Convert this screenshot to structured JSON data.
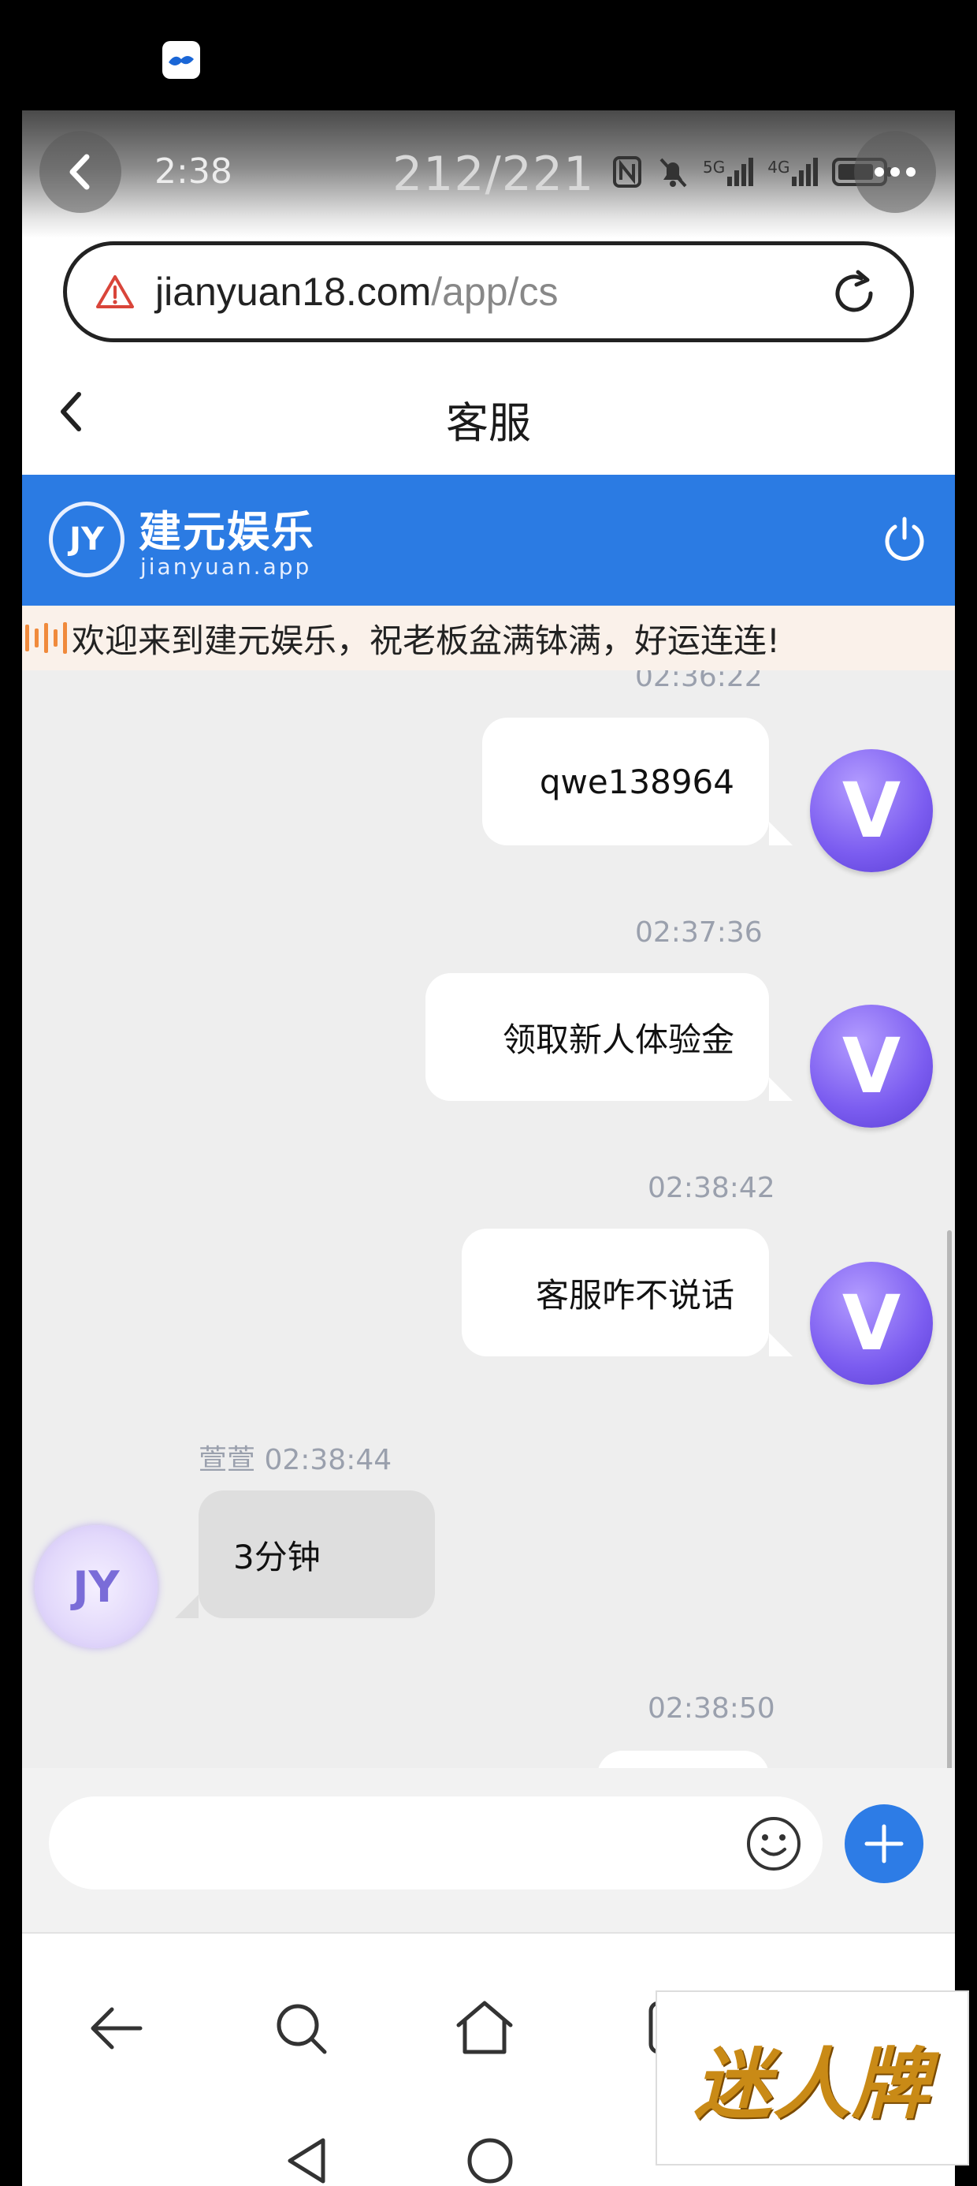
{
  "status_bar": {
    "time": "2:38",
    "page_counter": "212/221",
    "network_1": "5G",
    "network_2": "4G"
  },
  "browser": {
    "url_domain": "jianyuan18.com",
    "url_path": "/app/cs"
  },
  "page": {
    "title": "客服"
  },
  "banner": {
    "logo_text": "JY",
    "brand_cn": "建元娱乐",
    "brand_en": "jianyuan.app",
    "color": "#2b7be3"
  },
  "marquee": {
    "text": "欢迎来到建元娱乐，祝老板盆满钵满，好运连连!"
  },
  "chat": {
    "messages": [
      {
        "side": "right",
        "time": "02:36:22",
        "text": "qwe138964"
      },
      {
        "side": "right",
        "time": "02:37:36",
        "text": "领取新人体验金"
      },
      {
        "side": "right",
        "time": "02:38:42",
        "text": "客服咋不说话"
      },
      {
        "side": "left",
        "sender": "萱萱",
        "time": "02:38:44",
        "text": "3分钟"
      },
      {
        "side": "right",
        "time": "02:38:50",
        "text": ""
      }
    ],
    "user_avatar_letter": "V",
    "agent_avatar_letter": "JY"
  },
  "input": {
    "placeholder": ""
  },
  "watermark": {
    "text": "迷人牌"
  }
}
